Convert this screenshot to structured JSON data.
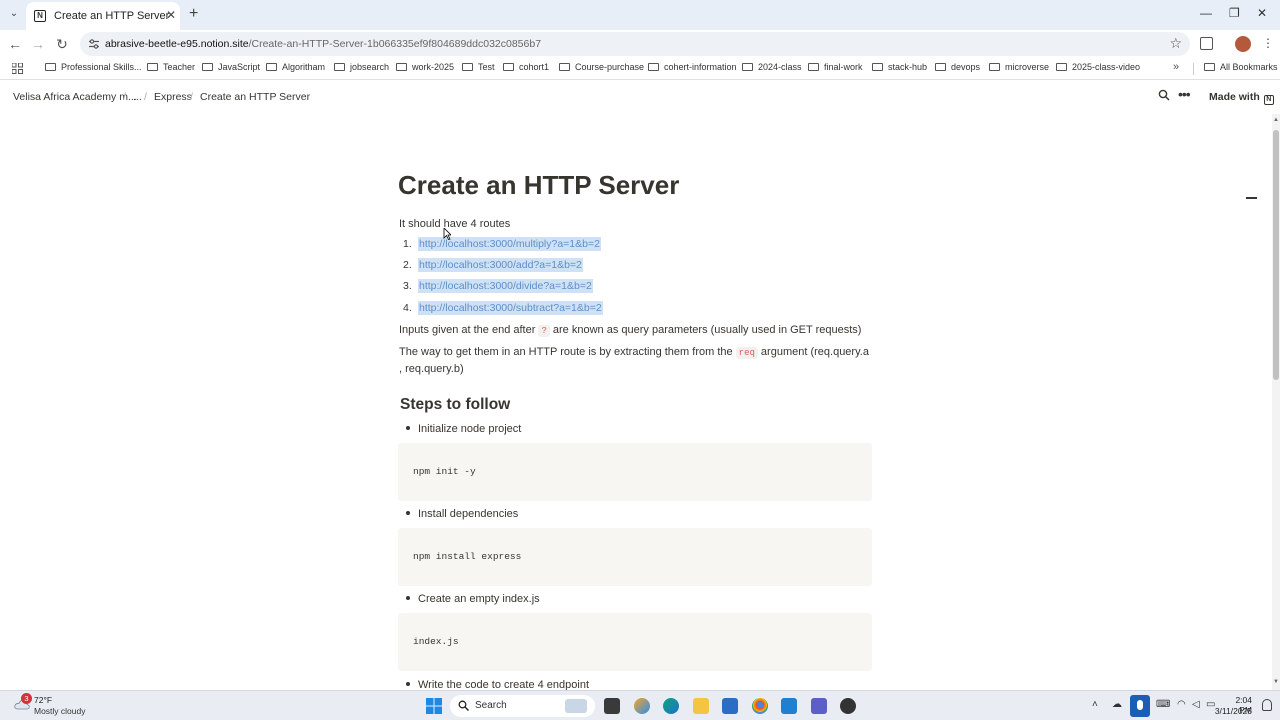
{
  "browser": {
    "tab_title": "Create an HTTP Server",
    "url_host": "abrasive-beetle-e95.notion.site",
    "url_path": "/Create-an-HTTP-Server-1b066335ef9f804689ddc032c0856b7"
  },
  "bookmarks": {
    "items": [
      "Professional Skills...",
      "Teacher",
      "JavaScript",
      "Algoritham",
      "jobsearch",
      "work-2025",
      "Test",
      "cohort1",
      "Course-purchase",
      "cohert-information",
      "2024-class",
      "final-work",
      "stack-hub",
      "devops",
      "microverse",
      "2025-class-video"
    ],
    "more": "»",
    "all_bookmarks": "All Bookmarks"
  },
  "notion": {
    "breadcrumb": [
      "Velisa Africa Academy m...",
      "...",
      "Express",
      "Create an HTTP Server"
    ],
    "made_with": "Made with"
  },
  "page": {
    "title": "Create an HTTP Server",
    "intro": "It should have 4 routes",
    "routes": [
      "http://localhost:3000/multiply?a=1&b=2",
      "http://localhost:3000/add?a=1&b=2",
      "http://localhost:3000/divide?a=1&b=2",
      "http://localhost:3000/subtract?a=1&b=2"
    ],
    "query_text_before": "Inputs given at the end after ",
    "query_code": "?",
    "query_text_after": " are known as query parameters (usually used in GET requests)",
    "extract_text_before": "The way to get them in an HTTP route is by extracting them from the ",
    "extract_code": "req",
    "extract_text_after": " argument (req.query.a , req.query.b)",
    "steps_heading": "Steps to follow",
    "steps": [
      {
        "label": "Initialize node project",
        "code": "npm init -y"
      },
      {
        "label": "Install dependencies",
        "code": "npm install express"
      },
      {
        "label": "Create an empty index.js",
        "code": "index.js"
      },
      {
        "label": "Write the code to create 4 endpoint",
        "code": ""
      }
    ]
  },
  "taskbar": {
    "weather_badge": "3",
    "temperature": "72°F",
    "condition": "Mostly cloudy",
    "search_label": "Search",
    "time": "2:04 PM",
    "date": "3/11/2025"
  }
}
